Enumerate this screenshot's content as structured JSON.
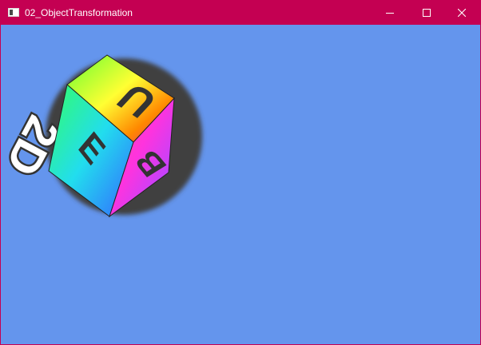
{
  "window": {
    "title": "02_ObjectTransformation",
    "background_color": "#6495ed",
    "titlebar_color": "#c40052",
    "controls": [
      "minimize-icon",
      "maximize-icon",
      "close-icon"
    ]
  },
  "scene": {
    "sprite_text": "2D",
    "cube_face_letters": [
      "U",
      "E",
      "B"
    ]
  }
}
